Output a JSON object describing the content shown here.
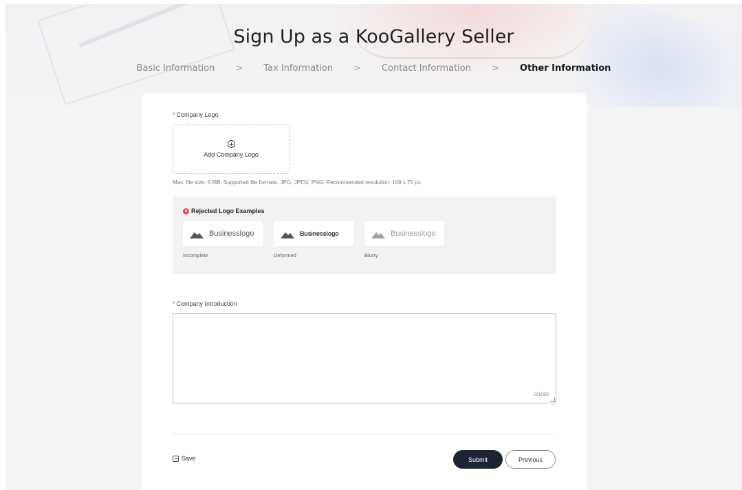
{
  "page": {
    "title": "Sign Up as a KooGallery Seller"
  },
  "steps": [
    {
      "label": "Basic Information",
      "active": false
    },
    {
      "label": "Tax Information",
      "active": false
    },
    {
      "label": "Contact Information",
      "active": false
    },
    {
      "label": "Other Information",
      "active": true
    }
  ],
  "step_separator": ">",
  "logo_field": {
    "required_mark": "*",
    "label": "Company Logo",
    "upload_icon": "plus-circle-icon",
    "upload_label": "Add Company Logo",
    "hint": "Max. file size: 5 MB. Supported file formats: JPG, JPEG, PNG. Recommended resolution: 168 x 70 px."
  },
  "rejected_examples": {
    "icon": "x-circle-icon",
    "icon_glyph": "×",
    "title": "Rejected Logo Examples",
    "items": [
      {
        "logo_text": "Businesslogo",
        "caption": "Incomplete",
        "style": "incomplete"
      },
      {
        "logo_text": "Businesslogo",
        "caption": "Deformed",
        "style": "deformed"
      },
      {
        "logo_text": "Businesslogo",
        "caption": "Blurry",
        "style": "blurry"
      }
    ]
  },
  "intro_field": {
    "required_mark": "*",
    "label": "Company Introduction",
    "value": "",
    "counter": "0/1000"
  },
  "footer": {
    "save_label": "Save",
    "submit_label": "Submit",
    "previous_label": "Previous"
  },
  "colors": {
    "required": "#e35050",
    "primary_button": "#1c2333",
    "reject_icon": "#e54848"
  }
}
